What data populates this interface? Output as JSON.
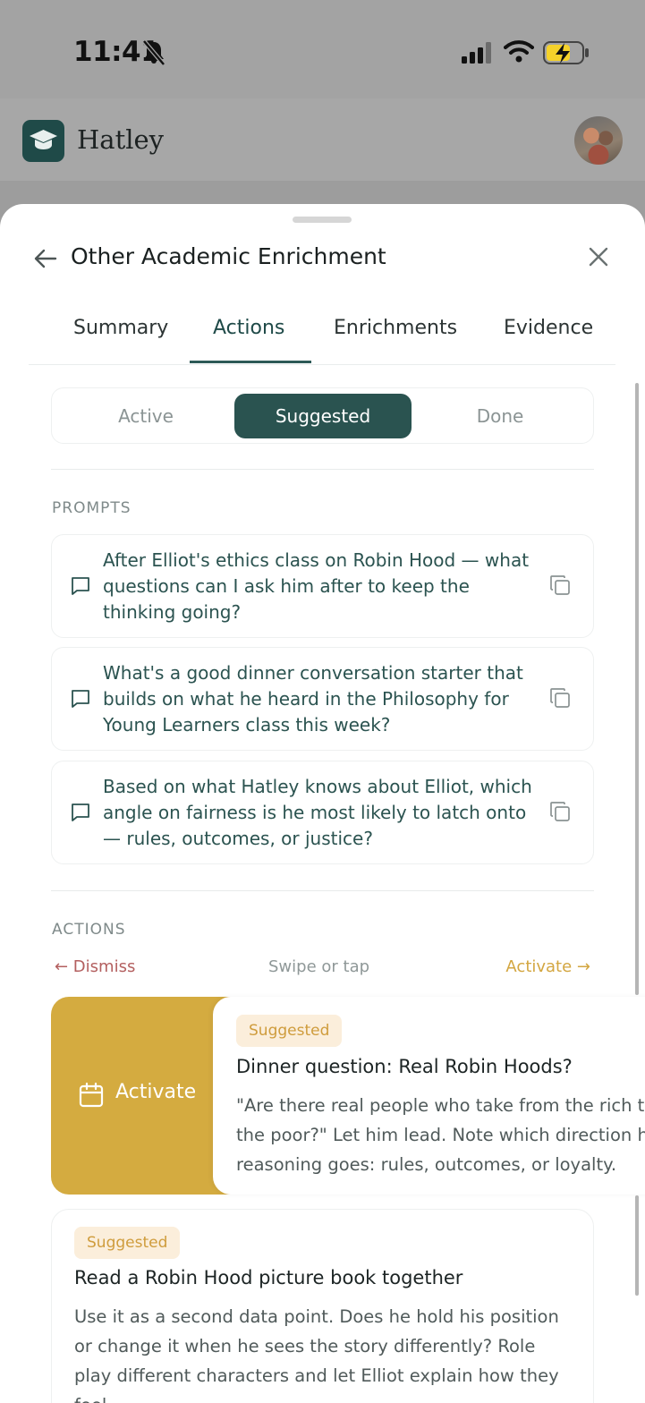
{
  "status_bar": {
    "time": "11:41",
    "icons": [
      "bell-slash-icon",
      "cellular-signal-icon",
      "wifi-icon",
      "battery-charging-icon"
    ]
  },
  "app": {
    "name": "Hatley",
    "logo_icon": "graduation-cap-icon",
    "brand_color": "#1f4a48"
  },
  "sheet": {
    "title": "Other Academic Enrichment",
    "back_icon": "arrow-left-icon",
    "close_icon": "close-icon"
  },
  "tabs": [
    {
      "label": "Summary",
      "selected": false
    },
    {
      "label": "Actions",
      "selected": true
    },
    {
      "label": "Enrichments",
      "selected": false
    },
    {
      "label": "Evidence",
      "selected": false
    }
  ],
  "filter": {
    "options": [
      "Active",
      "Suggested",
      "Done"
    ],
    "selected": "Suggested"
  },
  "prompts": {
    "header": "PROMPTS",
    "items": [
      "After Elliot's ethics class on Robin Hood — what questions can I ask him after to keep the thinking going?",
      "What's a good dinner conversation starter that builds on what he heard in the Philosophy for Young Learners class this week?",
      "Based on what Hatley knows about Elliot, which angle on fairness is he most likely to latch onto — rules, outcomes, or justice?"
    ]
  },
  "actions": {
    "header": "ACTIONS",
    "dismiss": "← Dismiss",
    "hint": "Swipe or tap",
    "activate_hint": "Activate →",
    "swipe_action_label": "Activate",
    "accent_color": "#d4ab40",
    "cards": [
      {
        "badge": "Suggested",
        "title": "Dinner question: Real Robin Hoods?",
        "body_lines": [
          "\"Are there real people who take from the rich t",
          "the poor?\" Let him lead. Note which direction h",
          "reasoning goes: rules, outcomes, or loyalty."
        ]
      },
      {
        "badge": "Suggested",
        "title": "Read a Robin Hood picture book together",
        "body_lines": [
          "Use it as a second data point. Does he hold his position",
          "or change it when he sees the story differently? Role",
          "play different characters and let Elliot explain how they",
          "feel."
        ]
      }
    ]
  }
}
